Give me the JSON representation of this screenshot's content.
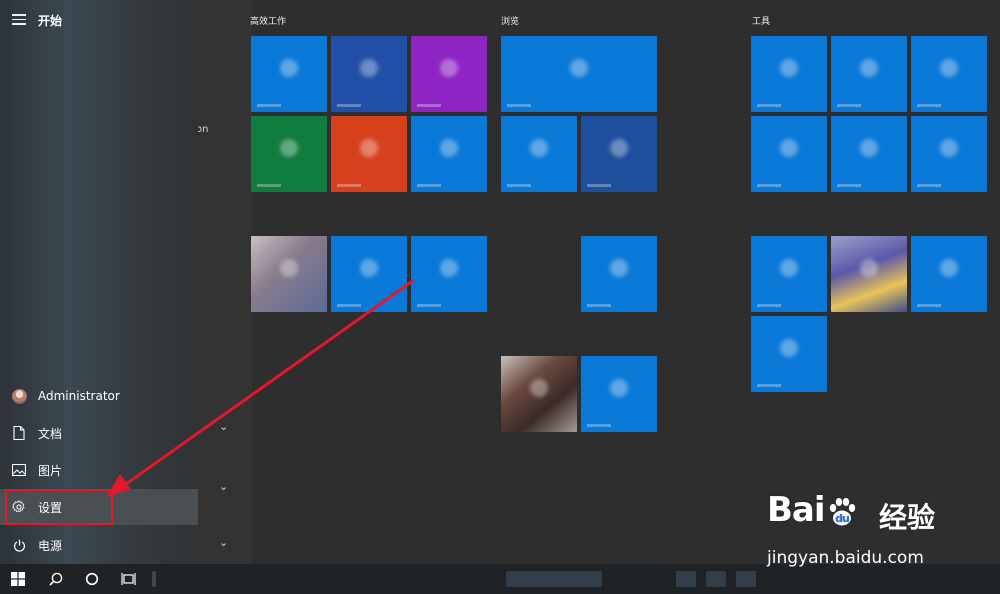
{
  "start_menu": {
    "title": "开始",
    "user_name": "Administrator",
    "items": [
      {
        "label": "文档",
        "icon": "document-icon"
      },
      {
        "label": "图片",
        "icon": "picture-icon"
      },
      {
        "label": "设置",
        "icon": "gear-icon"
      },
      {
        "label": "电源",
        "icon": "power-icon"
      }
    ],
    "selected_item": "设置"
  },
  "sliver_text": "on",
  "sections": [
    {
      "title": "高效工作"
    },
    {
      "title": "浏览"
    },
    {
      "title": "工具"
    }
  ],
  "colors": {
    "tile_blue": "#0a78d6",
    "tile_dark_blue": "#2250a8",
    "tile_purple": "#8e24c2",
    "tile_green": "#107c3e",
    "tile_orange": "#d6401c",
    "highlight_red": "#e3182a",
    "panel_bg": "#34393d",
    "taskbar_bg": "#1f2326"
  },
  "taskbar": {
    "buttons": [
      "windows-logo-icon",
      "search-icon",
      "cortana-icon",
      "task-view-icon"
    ]
  },
  "watermark": {
    "logo": "Bai",
    "logo_cn": "经验",
    "url": "jingyan.baidu.com"
  }
}
